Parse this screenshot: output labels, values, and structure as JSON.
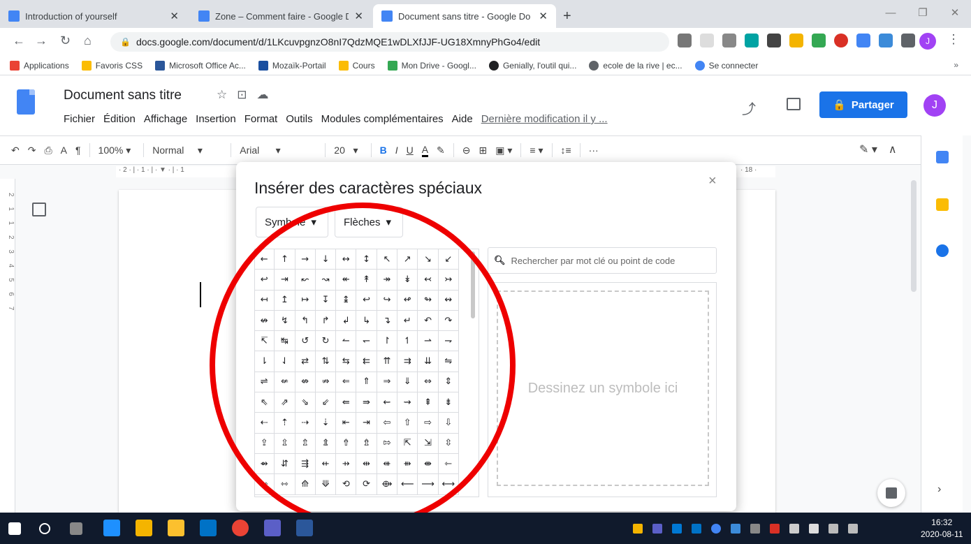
{
  "browser": {
    "tabs": [
      {
        "label": "Introduction of yourself",
        "icon": "slides-icon",
        "color": "#4285f4"
      },
      {
        "label": "Zone – Comment faire - Google D",
        "icon": "docs-icon",
        "color": "#4285f4"
      },
      {
        "label": "Document sans titre - Google Do",
        "icon": "docs-icon",
        "color": "#4285f4"
      }
    ],
    "new_tab": "+",
    "url": "docs.google.com/document/d/1LKcuvpgnzO8nI7QdzMQE1wDLXfJJF-UG18XmnyPhGo4/edit",
    "profile_initial": "J",
    "bookmarks": [
      {
        "label": "Applications",
        "color": "#ea4335"
      },
      {
        "label": "Favoris CSS",
        "color": "#fbbc04"
      },
      {
        "label": "Microsoft Office Ac...",
        "color": "#2b579a"
      },
      {
        "label": "Mozaïk-Portail",
        "color": "#1a4fa0"
      },
      {
        "label": "Cours",
        "color": "#fbbc04"
      },
      {
        "label": "Mon Drive - Googl...",
        "color": "#34a853"
      },
      {
        "label": "Genially, l'outil qui...",
        "color": "#202124"
      },
      {
        "label": "ecole de la rive | ec...",
        "color": "#5f6368"
      },
      {
        "label": "Se connecter",
        "color": "#4285f4"
      }
    ],
    "bookmarks_more": "»"
  },
  "docs": {
    "title": "Document sans titre",
    "menus": [
      "Fichier",
      "Édition",
      "Affichage",
      "Insertion",
      "Format",
      "Outils",
      "Modules complémentaires",
      "Aide"
    ],
    "last_edit": "Dernière modification il y ...",
    "share_label": "Partager",
    "avatar_initial": "J",
    "toolbar": {
      "zoom": "100%",
      "style": "Normal",
      "font": "Arial",
      "size": "20",
      "more": "···"
    },
    "ruler_text": "· 2 · | · 1 · | · ▼ · | · 1",
    "ruler_right": "· 18 ·",
    "vruler_text": "2 1 1 2 3 4 5 6 7"
  },
  "dialog": {
    "title": "Insérer des caractères spéciaux",
    "close": "×",
    "dropdown1": "Symbole",
    "dropdown2": "Flèches",
    "search_placeholder": "Rechercher par mot clé ou point de code",
    "draw_label": "Dessinez un symbole ici",
    "symbols": [
      "←",
      "↑",
      "→",
      "↓",
      "↔",
      "↕",
      "↖",
      "↗",
      "↘",
      "↙",
      "↩",
      "⇥",
      "↜",
      "↝",
      "↞",
      "↟",
      "↠",
      "↡",
      "↢",
      "↣",
      "↤",
      "↥",
      "↦",
      "↧",
      "↨",
      "↩",
      "↪",
      "↫",
      "↬",
      "↭",
      "↮",
      "↯",
      "↰",
      "↱",
      "↲",
      "↳",
      "↴",
      "↵",
      "↶",
      "↷",
      "↸",
      "↹",
      "↺",
      "↻",
      "↼",
      "↽",
      "↾",
      "↿",
      "⇀",
      "⇁",
      "⇂",
      "⇃",
      "⇄",
      "⇅",
      "⇆",
      "⇇",
      "⇈",
      "⇉",
      "⇊",
      "⇋",
      "⇌",
      "⇍",
      "⇎",
      "⇏",
      "⇐",
      "⇑",
      "⇒",
      "⇓",
      "⇔",
      "⇕",
      "⇖",
      "⇗",
      "⇘",
      "⇙",
      "⇚",
      "⇛",
      "⇜",
      "⇝",
      "⇞",
      "⇟",
      "⇠",
      "⇡",
      "⇢",
      "⇣",
      "⇤",
      "⇥",
      "⇦",
      "⇧",
      "⇨",
      "⇩",
      "⇪",
      "⇫",
      "⇬",
      "⇭",
      "⇮",
      "⇯",
      "⇰",
      "⇱",
      "⇲",
      "⇳",
      "⇴",
      "⇵",
      "⇶",
      "⇷",
      "⇸",
      "⇹",
      "⇺",
      "⇻",
      "⇼",
      "⇽",
      "⇾",
      "⇿",
      "⟰",
      "⟱",
      "⟲",
      "⟳",
      "⟴",
      "⟵",
      "⟶",
      "⟷"
    ]
  },
  "taskbar": {
    "time": "16:32",
    "date": "2020-08-11"
  },
  "colors": {
    "accent": "#1a73e8",
    "annotation": "#ee0000"
  }
}
